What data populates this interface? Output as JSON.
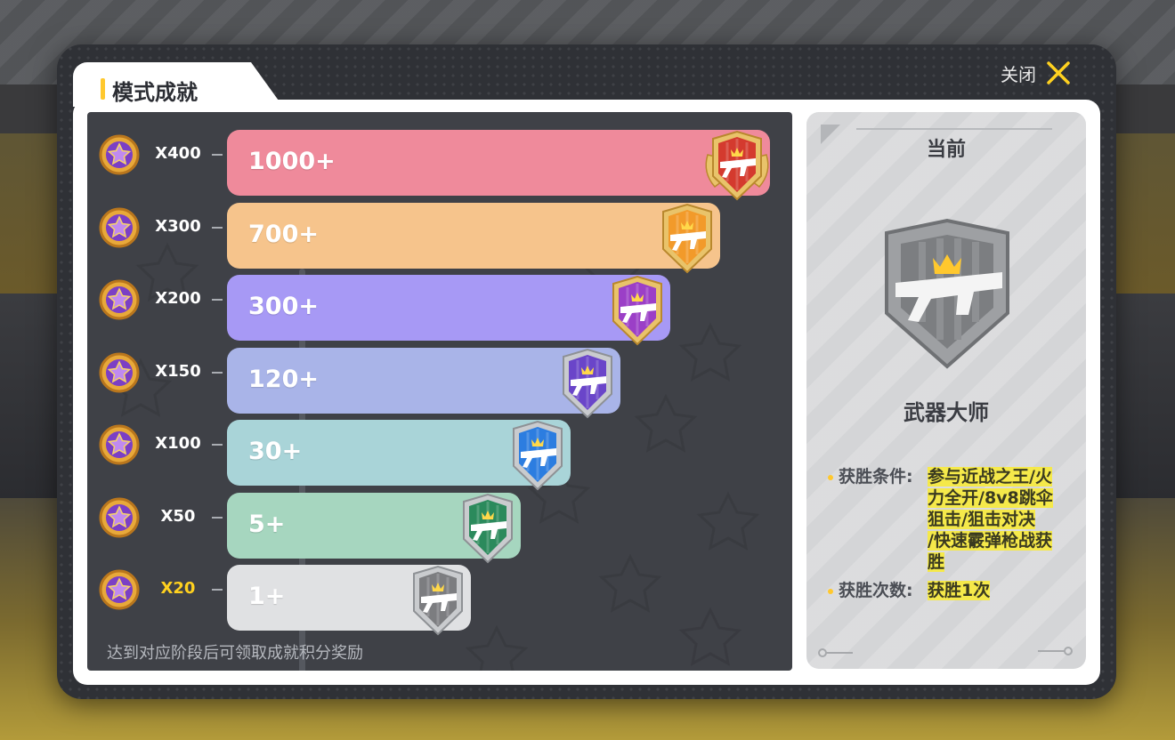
{
  "window": {
    "title": "模式成就",
    "close_label": "关闭"
  },
  "tiers": [
    {
      "reward": "X400",
      "threshold": "1000+",
      "bar_color": "#ef8a9b",
      "badge_color": "#d43a2e",
      "frame": "gold-wings",
      "fill": 1.0
    },
    {
      "reward": "X300",
      "threshold": "700+",
      "bar_color": "#f6c48c",
      "badge_color": "#f29a2a",
      "frame": "gold",
      "fill": 0.9
    },
    {
      "reward": "X200",
      "threshold": "300+",
      "bar_color": "#a799f5",
      "badge_color": "#9b3fc7",
      "frame": "gold",
      "fill": 0.8
    },
    {
      "reward": "X150",
      "threshold": "120+",
      "bar_color": "#a9b4e8",
      "badge_color": "#6a45c9",
      "frame": "silver",
      "fill": 0.7
    },
    {
      "reward": "X100",
      "threshold": "30+",
      "bar_color": "#a9d4d8",
      "badge_color": "#2c7de0",
      "frame": "silver",
      "fill": 0.6
    },
    {
      "reward": "X50",
      "threshold": "5+",
      "bar_color": "#a6d6bf",
      "badge_color": "#2b8a5c",
      "frame": "silver",
      "fill": 0.5
    },
    {
      "reward": "X20",
      "threshold": "1+",
      "bar_color": "#e0e1e3",
      "badge_color": "#7c7d80",
      "frame": "silver",
      "fill": 0.4,
      "active": true
    }
  ],
  "hint": "达到对应阶段后可领取成就积分奖励",
  "current": {
    "title": "当前",
    "badge_name": "武器大师",
    "condition_label": "获胜条件:",
    "condition_lines": [
      "参与近战之王/火",
      "力全开/8v8跳伞",
      "狙击/狙击对决",
      "/快速霰弹枪战获",
      "胜"
    ],
    "count_label": "获胜次数:",
    "count_value": "获胜1次"
  },
  "icons": {
    "reward": "star-coin-icon",
    "badge": "rifle-crown-badge-icon",
    "close": "close-x-icon"
  }
}
